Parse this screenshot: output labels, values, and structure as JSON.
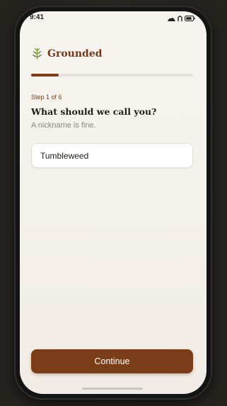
{
  "status_bar": {
    "time": "9:41",
    "icons": [
      "cellular-icon",
      "wifi-icon",
      "battery-icon"
    ]
  },
  "brand": {
    "icon": "leaf-icon",
    "name": "Grounded"
  },
  "progress": {
    "current_step": 1,
    "total_steps": 6,
    "fraction": 0.17
  },
  "step_label": "Step 1 of 6",
  "question": "What should we call you?",
  "hint": "A nickname is fine.",
  "name_input": {
    "value": "Tumbleweed"
  },
  "continue_label": "Continue",
  "colors": {
    "accent": "#7a3d17",
    "brand_text": "#6e3a17",
    "background": "#f4f0ea",
    "muted_text": "#8a847e"
  }
}
